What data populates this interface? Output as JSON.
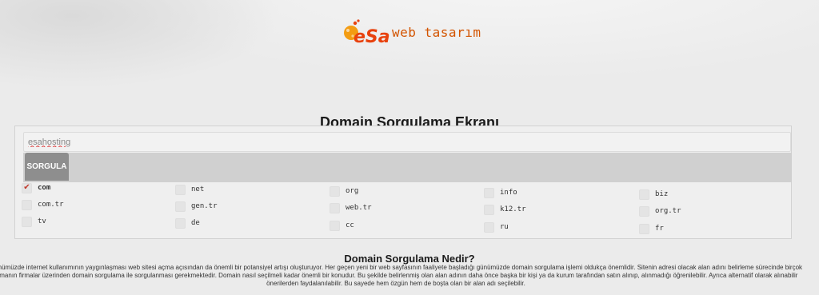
{
  "brand": {
    "logo_letters": "eSa",
    "tagline": "web tasarım",
    "colors": {
      "primary": "#e8420e",
      "secondary": "#f39c12"
    }
  },
  "page_title": "Domain Sorgulama Ekranı",
  "search": {
    "value": "esahosting",
    "placeholder": ""
  },
  "submit_label": "SORGULA",
  "tlds": [
    {
      "label": "com",
      "checked": true
    },
    {
      "label": "net",
      "checked": false
    },
    {
      "label": "org",
      "checked": false
    },
    {
      "label": "info",
      "checked": false
    },
    {
      "label": "biz",
      "checked": false
    },
    {
      "label": "com.tr",
      "checked": false
    },
    {
      "label": "gen.tr",
      "checked": false
    },
    {
      "label": "web.tr",
      "checked": false
    },
    {
      "label": "k12.tr",
      "checked": false
    },
    {
      "label": "org.tr",
      "checked": false
    },
    {
      "label": "tv",
      "checked": false
    },
    {
      "label": "de",
      "checked": false
    },
    {
      "label": "cc",
      "checked": false
    },
    {
      "label": "ru",
      "checked": false
    },
    {
      "label": "fr",
      "checked": false
    }
  ],
  "check_mark": "✔",
  "section_title": "Domain Sorgulama Nedir?",
  "description": [
    "Günümüzde internet kullanımının yaygınlaşması web sitesi açma açısından da önemli bir potansiyel artışı oluşturuyor. Her geçen yeni bir web sayfasının faaliyete başladığı günümüzde domain sorgulama işlemi oldukça önemlidir. Sitenin adresi olacak alan adını belirleme sürecinde birçok",
    "firmanın firmalar üzerinden domain sorgulama ile sorgulanması gerekmektedir. Domain nasıl seçilmeli kadar önemli bir konudur. Bu şekilde belirlenmiş olan alan adının daha önce başka bir kişi ya da kurum tarafından satın alınıp, alınmadığı öğrenilebilir. Ayrıca alternatif olarak alınabilir",
    "önerilerden faydalanılabilir. Bu sayede hem özgün hem de boşta olan bir alan adı seçilebilir."
  ]
}
